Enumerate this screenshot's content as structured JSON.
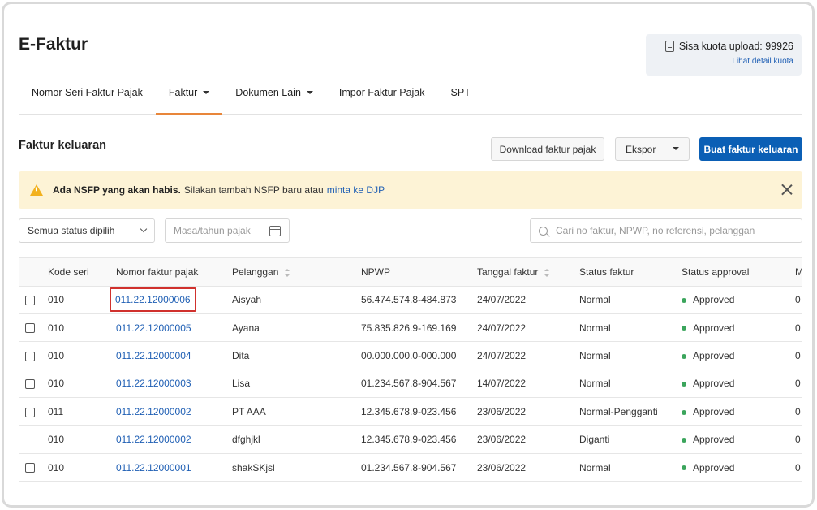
{
  "page": {
    "title": "E-Faktur"
  },
  "quota": {
    "label": "Sisa kuota upload: 99926",
    "link": "Lihat detail kuota"
  },
  "tabs": [
    {
      "label": "Nomor Seri Faktur Pajak",
      "dropdown": false,
      "active": false
    },
    {
      "label": "Faktur",
      "dropdown": true,
      "active": true
    },
    {
      "label": "Dokumen Lain",
      "dropdown": true,
      "active": false
    },
    {
      "label": "Impor Faktur Pajak",
      "dropdown": false,
      "active": false
    },
    {
      "label": "SPT",
      "dropdown": false,
      "active": false
    }
  ],
  "section": {
    "title": "Faktur keluaran",
    "download_label": "Download faktur pajak",
    "export_label": "Ekspor",
    "create_label": "Buat faktur keluaran"
  },
  "alert": {
    "bold": "Ada NSFP yang akan habis.",
    "text": "Silakan tambah NSFP baru atau",
    "link": "minta ke DJP",
    "color": "#fdf3d6"
  },
  "filters": {
    "status_value": "Semua status dipilih",
    "date_placeholder": "Masa/tahun pajak",
    "search_placeholder": "Cari no faktur, NPWP, no referensi, pelanggan"
  },
  "table": {
    "headers": [
      "Kode seri",
      "Nomor faktur pajak",
      "Pelanggan",
      "NPWP",
      "Tanggal faktur",
      "Status faktur",
      "Status approval",
      "M"
    ],
    "rows": [
      {
        "checkbox": true,
        "kode": "010",
        "nomor": "011.22.12000006",
        "pelanggan": "Aisyah",
        "npwp": "56.474.574.8-484.873",
        "tanggal": "24/07/2022",
        "status": "Normal",
        "approval": "Approved",
        "m": "0",
        "highlight": true
      },
      {
        "checkbox": true,
        "kode": "010",
        "nomor": "011.22.12000005",
        "pelanggan": "Ayana",
        "npwp": "75.835.826.9-169.169",
        "tanggal": "24/07/2022",
        "status": "Normal",
        "approval": "Approved",
        "m": "0",
        "highlight": false
      },
      {
        "checkbox": true,
        "kode": "010",
        "nomor": "011.22.12000004",
        "pelanggan": "Dita",
        "npwp": "00.000.000.0-000.000",
        "tanggal": "24/07/2022",
        "status": "Normal",
        "approval": "Approved",
        "m": "0",
        "highlight": false
      },
      {
        "checkbox": true,
        "kode": "010",
        "nomor": "011.22.12000003",
        "pelanggan": "Lisa",
        "npwp": "01.234.567.8-904.567",
        "tanggal": "14/07/2022",
        "status": "Normal",
        "approval": "Approved",
        "m": "0",
        "highlight": false
      },
      {
        "checkbox": true,
        "kode": "011",
        "nomor": "011.22.12000002",
        "pelanggan": "PT AAA",
        "npwp": "12.345.678.9-023.456",
        "tanggal": "23/06/2022",
        "status": "Normal-Pengganti",
        "approval": "Approved",
        "m": "0",
        "highlight": false
      },
      {
        "checkbox": false,
        "kode": "010",
        "nomor": "011.22.12000002",
        "pelanggan": "dfghjkl",
        "npwp": "12.345.678.9-023.456",
        "tanggal": "23/06/2022",
        "status": "Diganti",
        "approval": "Approved",
        "m": "0",
        "highlight": false
      },
      {
        "checkbox": true,
        "kode": "010",
        "nomor": "011.22.12000001",
        "pelanggan": "shakSKjsl",
        "npwp": "01.234.567.8-904.567",
        "tanggal": "23/06/2022",
        "status": "Normal",
        "approval": "Approved",
        "m": "0",
        "highlight": false
      }
    ]
  },
  "colors": {
    "accent": "#e8863a",
    "primary": "#0b5fb5",
    "link": "#1f5fb4",
    "approved": "#3ba55c",
    "highlight": "#d0312d"
  }
}
